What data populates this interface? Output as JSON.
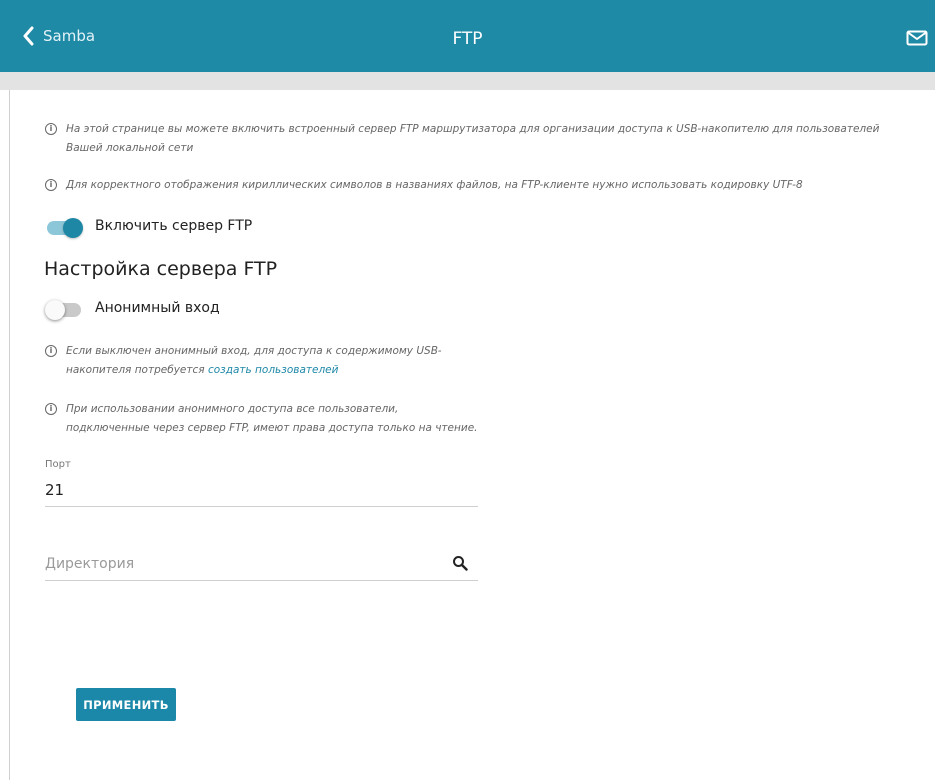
{
  "header": {
    "back_label": "Samba",
    "title": "FTP",
    "back_icon": "chevron-left-icon",
    "mail_icon": "mail-icon"
  },
  "info": {
    "intro": "На этой странице вы можете включить встроенный сервер FTP маршрутизатора для организации доступа к USB-накопителю для пользователей Вашей локальной сети",
    "encoding": "Для корректного отображения кириллических символов в названиях файлов, на FTP-клиенте нужно использовать кодировку UTF-8",
    "anon_off_text": "Если выключен анонимный вход, для доступа к содержимому USB-накопителя потребуется",
    "anon_off_link": "создать пользователей",
    "anon_on_text": "При использовании анонимного доступа все пользователи, подключенные через сервер FTP, имеют права доступа только на чтение."
  },
  "enable_ftp": {
    "label": "Включить сервер FTP",
    "checked": true
  },
  "section": {
    "title": "Настройка сервера FTP"
  },
  "anonymous": {
    "label": "Анонимный вход",
    "checked": false
  },
  "port": {
    "label": "Порт",
    "value": "21"
  },
  "directory": {
    "placeholder": "Директория",
    "value": ""
  },
  "apply_button": "ПРИМЕНИТЬ",
  "colors": {
    "header_bg": "#1f8aa6",
    "accent": "#1b88a9",
    "link": "#1e88a8"
  }
}
